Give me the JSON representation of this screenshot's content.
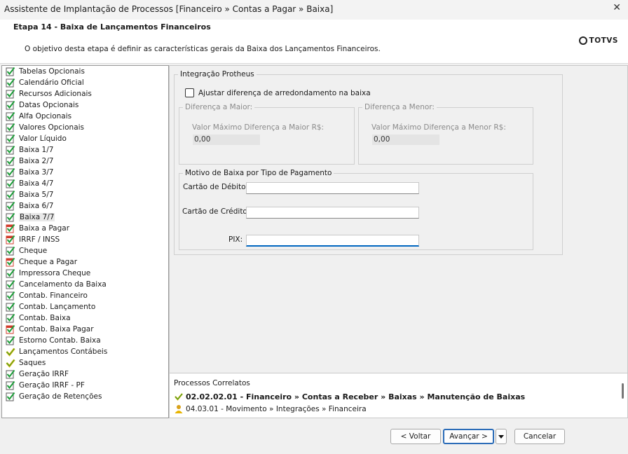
{
  "window": {
    "title": "Assistente de Implantação de Processos [Financeiro » Contas a Pagar » Baixa]"
  },
  "header": {
    "step_title": "Etapa 14 - Baixa de Lançamentos Financeiros",
    "description": "O objetivo desta etapa é definir as características gerais da Baixa dos Lançamentos Financeiros.",
    "logo_text": "TOTVS"
  },
  "sidebar": {
    "items": [
      {
        "label": "Tabelas Opcionais",
        "icon": "green-check-icon"
      },
      {
        "label": "Calendário Oficial",
        "icon": "green-check-icon"
      },
      {
        "label": "Recursos Adicionais",
        "icon": "green-check-icon"
      },
      {
        "label": "Datas Opcionais",
        "icon": "green-check-icon"
      },
      {
        "label": "Alfa Opcionais",
        "icon": "green-check-icon"
      },
      {
        "label": "Valores Opcionais",
        "icon": "green-check-icon"
      },
      {
        "label": "Valor Líquido",
        "icon": "green-check-icon"
      },
      {
        "label": "Baixa 1/7",
        "icon": "green-check-icon"
      },
      {
        "label": "Baixa 2/7",
        "icon": "green-check-icon"
      },
      {
        "label": "Baixa 3/7",
        "icon": "green-check-icon"
      },
      {
        "label": "Baixa 4/7",
        "icon": "green-check-icon"
      },
      {
        "label": "Baixa 5/7",
        "icon": "green-check-icon"
      },
      {
        "label": "Baixa 6/7",
        "icon": "green-check-icon"
      },
      {
        "label": "Baixa 7/7",
        "icon": "green-check-icon",
        "selected": true
      },
      {
        "label": "Baixa a Pagar",
        "icon": "red-check-icon"
      },
      {
        "label": "IRRF / INSS",
        "icon": "red-check-icon"
      },
      {
        "label": "Cheque",
        "icon": "green-check-icon"
      },
      {
        "label": "Cheque a Pagar",
        "icon": "red-check-icon"
      },
      {
        "label": "Impressora Cheque",
        "icon": "green-check-icon"
      },
      {
        "label": "Cancelamento da Baixa",
        "icon": "green-check-icon"
      },
      {
        "label": "Contab. Financeiro",
        "icon": "green-check-icon"
      },
      {
        "label": "Contab. Lançamento",
        "icon": "green-check-icon"
      },
      {
        "label": "Contab. Baixa",
        "icon": "green-check-icon"
      },
      {
        "label": "Contab. Baixa Pagar",
        "icon": "red-check-icon"
      },
      {
        "label": "Estorno Contab. Baixa",
        "icon": "green-check-icon"
      },
      {
        "label": "Lançamentos Contábeis",
        "icon": "yellow-check-icon"
      },
      {
        "label": "Saques",
        "icon": "yellow-check-icon"
      },
      {
        "label": "Geração IRRF",
        "icon": "green-check-icon"
      },
      {
        "label": "Geração IRRF - PF",
        "icon": "green-check-icon"
      },
      {
        "label": "Geração de Retenções",
        "icon": "green-check-icon"
      }
    ]
  },
  "integration": {
    "legend": "Integração Protheus",
    "checkbox_label": "Ajustar diferença de arredondamento na baixa",
    "maior": {
      "legend": "Diferença a Maior:",
      "label": "Valor Máximo Diferença a Maior R$:",
      "value": "0,00"
    },
    "menor": {
      "legend": "Diferença a Menor:",
      "label": "Valor Máximo Diferença a Menor R$:",
      "value": "0,00"
    },
    "motivo": {
      "legend": "Motivo de Baixa por Tipo de Pagamento",
      "debito_label": "Cartão de Débito:",
      "credito_label": "Cartão de Crédito:",
      "pix_label": "PIX:",
      "debito_value": "",
      "credito_value": "",
      "pix_value": ""
    }
  },
  "related": {
    "title": "Processos Correlatos",
    "items": [
      {
        "text": "02.02.02.01 - Financeiro » Contas a Receber » Baixas » Manutenção de Baixas",
        "icon": "yellow-check-icon"
      },
      {
        "text": "04.03.01 - Movimento » Integrações » Financeira",
        "icon": "person-icon"
      }
    ]
  },
  "footer": {
    "back_label": "< Voltar",
    "next_label": "Avançar >",
    "cancel_label": "Cancelar"
  },
  "colors": {
    "accent": "#0067c0",
    "check_green": "#1e9e3a",
    "check_red": "#d23a2a",
    "check_yellow": "#e8b400"
  }
}
